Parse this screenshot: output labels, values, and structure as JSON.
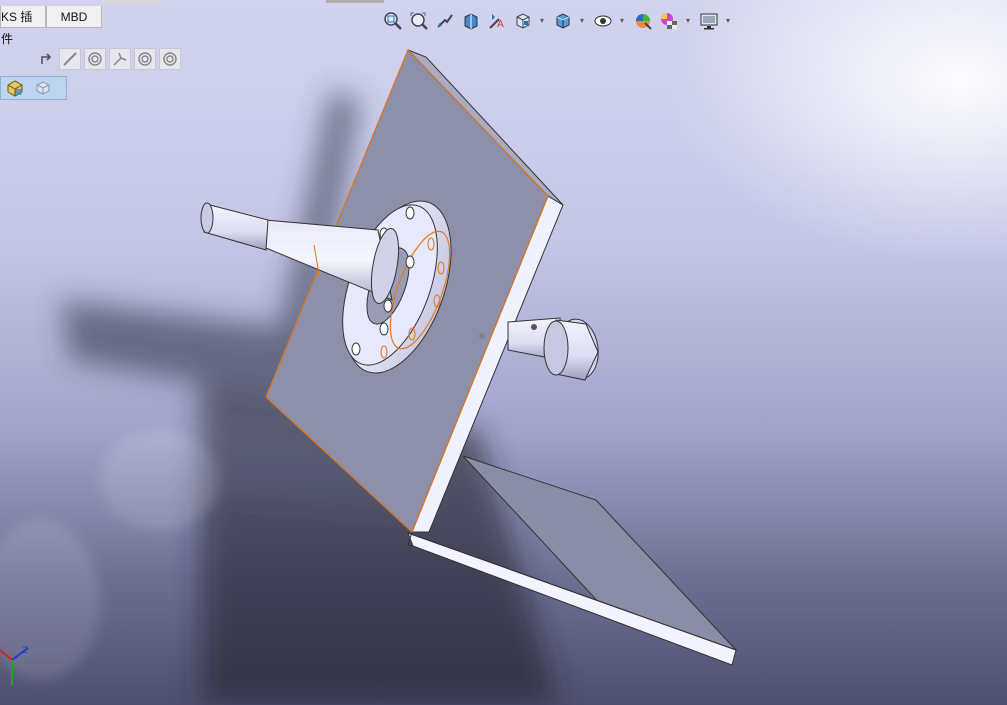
{
  "command_manager": {
    "tabs": [
      {
        "label": "KS 插件"
      },
      {
        "label": "MBD"
      }
    ]
  },
  "heads_up_toolbar": {
    "items": [
      {
        "icon": "zoom-to-fit-icon"
      },
      {
        "icon": "zoom-to-area-icon"
      },
      {
        "icon": "previous-view-icon"
      },
      {
        "icon": "section-view-icon"
      },
      {
        "icon": "dynamic-annotation-views-icon"
      },
      {
        "icon": "view-orientation-icon",
        "dropdown": true
      },
      {
        "icon": "display-style-icon",
        "dropdown": true
      },
      {
        "icon": "hide-show-items-icon",
        "dropdown": true
      },
      {
        "icon": "edit-appearance-icon"
      },
      {
        "icon": "apply-scene-icon",
        "dropdown": true
      },
      {
        "icon": "view-settings-icon",
        "dropdown": true
      }
    ]
  },
  "selection_toolbar": {
    "items": [
      {
        "icon": "select-arrow-icon"
      },
      {
        "icon": "select-edge-icon"
      },
      {
        "icon": "select-face-icon"
      },
      {
        "icon": "select-vertex-icon"
      },
      {
        "icon": "select-loop-icon"
      },
      {
        "icon": "select-circle-icon"
      }
    ]
  },
  "feature_manager_flyout": {
    "items": [
      {
        "icon": "part-icon"
      },
      {
        "icon": "component-icon"
      }
    ]
  },
  "colors": {
    "plate_face": "#8d90a8",
    "plate_edge": "#eef0fb",
    "highlight_edge": "#e07a20",
    "shaft": "#dcdcf4"
  }
}
